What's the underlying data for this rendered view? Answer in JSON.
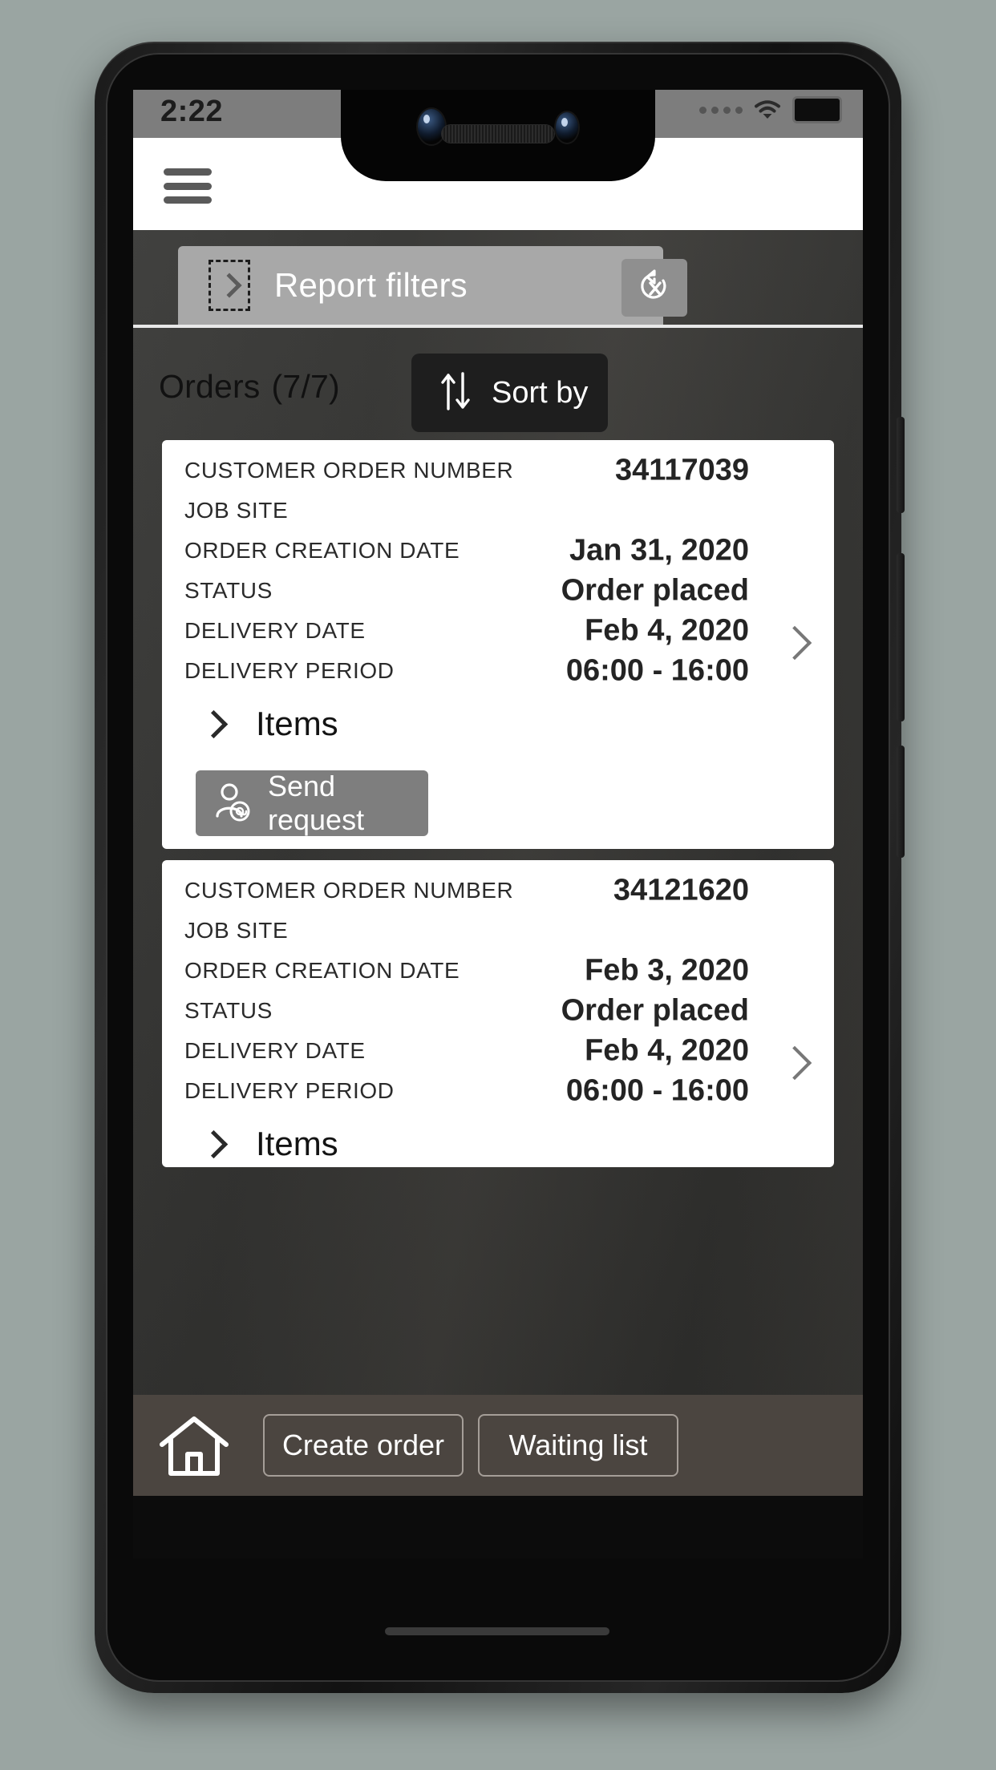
{
  "status_bar": {
    "time": "2:22",
    "icons": [
      "signal-dots",
      "wifi-icon",
      "battery-icon"
    ]
  },
  "app_bar": {
    "menu_icon": "hamburger-menu-icon"
  },
  "filter_bar": {
    "expand_icon": "chevron-right-icon",
    "label": "Report filters",
    "reset_icon": "reset-filters-icon"
  },
  "orders_header": {
    "title": "Orders",
    "count": "(7/7)",
    "sort_button": {
      "icon": "sort-arrows-icon",
      "label": "Sort by"
    }
  },
  "field_labels": {
    "customer_order_number": "CUSTOMER ORDER NUMBER",
    "job_site": "JOB SITE",
    "order_creation_date": "ORDER CREATION DATE",
    "status": "STATUS",
    "delivery_date": "DELIVERY DATE",
    "delivery_period": "DELIVERY PERIOD"
  },
  "orders": [
    {
      "customer_order_number": "34117039",
      "job_site": "",
      "order_creation_date": "Jan 31, 2020",
      "status": "Order placed",
      "delivery_date": "Feb 4, 2020",
      "delivery_period": "06:00 - 16:00",
      "items_label": "Items",
      "items_icon": "chevron-right-icon",
      "detail_icon": "chevron-right-icon",
      "send_request": {
        "label": "Send request",
        "icon": "user-email-icon"
      }
    },
    {
      "customer_order_number": "34121620",
      "job_site": "",
      "order_creation_date": "Feb 3, 2020",
      "status": "Order placed",
      "delivery_date": "Feb 4, 2020",
      "delivery_period": "06:00 - 16:00",
      "items_label": "Items",
      "items_icon": "chevron-right-icon",
      "detail_icon": "chevron-right-icon"
    }
  ],
  "bottom_nav": {
    "home_icon": "home-icon",
    "create_order": "Create order",
    "waiting_list": "Waiting list"
  },
  "colors": {
    "app_bar_bg": "#ffffff",
    "filter_bar_bg": "#a8a8a8",
    "content_bg": "#383734",
    "card_bg": "#ffffff",
    "sort_button_bg": "#1e1e1e",
    "send_button_bg": "#7e7e7e",
    "bottom_nav_bg": "#4b4540",
    "outer_bg": "#9aa5a2"
  }
}
